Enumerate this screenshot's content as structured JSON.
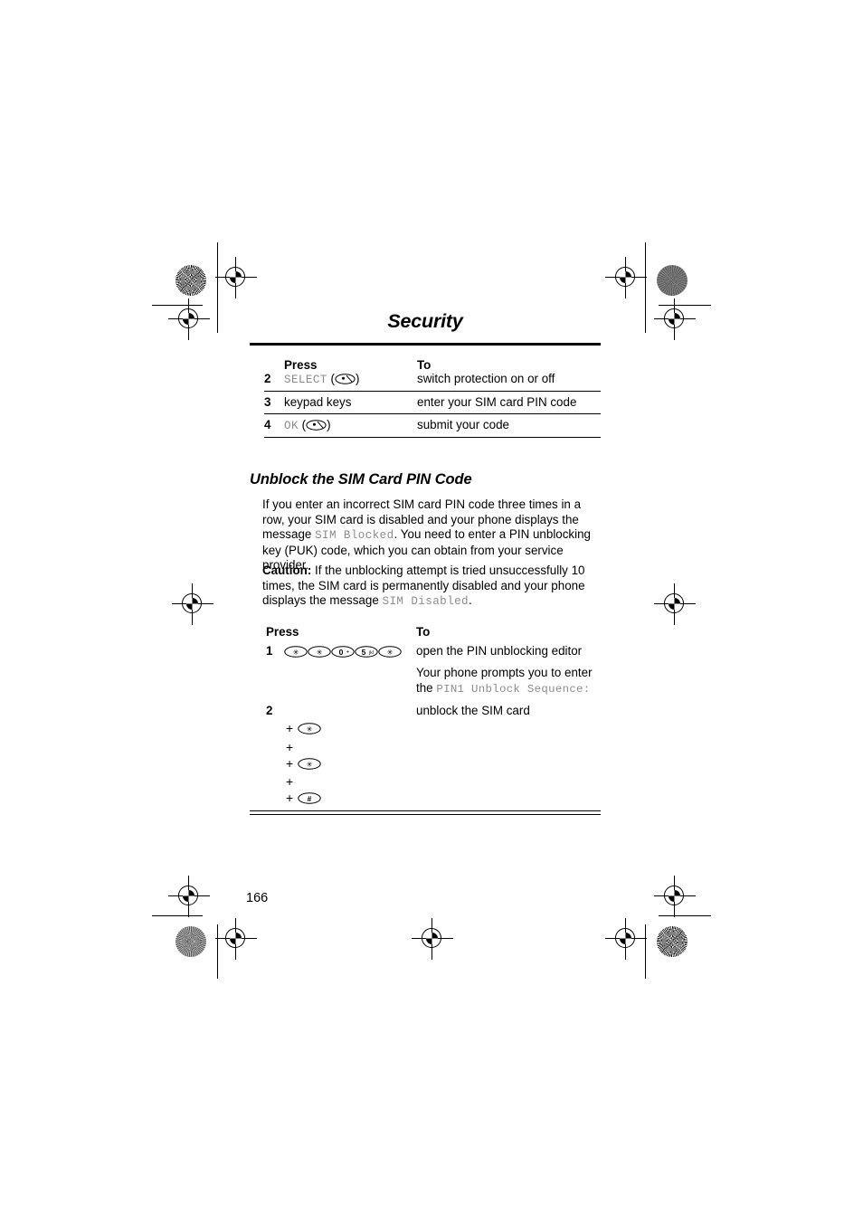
{
  "page": {
    "chapter_title": "Security",
    "page_number": "166",
    "section_heading": "Unblock the SIM Card PIN Code"
  },
  "table_one": {
    "header_press": "Press",
    "header_to": "To",
    "rows": [
      {
        "num": "2",
        "press_text": "SELECT",
        "press_style": "mono",
        "press_icon": "softkey-oval-icon",
        "to": "switch protection on or off"
      },
      {
        "num": "3",
        "press_text": "keypad keys",
        "press_style": "plain",
        "press_icon": "",
        "to": "enter your SIM card PIN code"
      },
      {
        "num": "4",
        "press_text": "OK",
        "press_style": "mono",
        "press_icon": "softkey-oval-icon",
        "to": "submit your code"
      }
    ]
  },
  "body": {
    "para1_part1": "If you enter an incorrect SIM card PIN code three times in a row, your SIM card is disabled and your phone displays the message ",
    "para1_code1": "SIM Blocked",
    "para1_part2": ". You need to enter a PIN unblocking key (PUK) code, which you can obtain from your service provider.",
    "para2_label": "Caution:",
    "para2_part1": " If the unblocking attempt is tried unsuccessfully 10 times, the SIM card is permanently disabled and your phone displays the message ",
    "para2_code1": "SIM Disabled",
    "para2_part2": "."
  },
  "table_two": {
    "header_press": "Press",
    "header_to": "To",
    "step1": {
      "num": "1",
      "keys": [
        {
          "label": "*",
          "sub": ""
        },
        {
          "label": "*",
          "sub": ""
        },
        {
          "label": "0",
          "sub": "+"
        },
        {
          "label": "5",
          "sub": "jkl"
        },
        {
          "label": "*",
          "sub": ""
        }
      ],
      "to_line1": "open the PIN unblocking editor",
      "to_line2a": "Your phone prompts you to enter the ",
      "to_line2b": "PIN1 Unblock Sequence:"
    },
    "step2": {
      "num": "2",
      "to": "unblock the SIM card",
      "sequence": [
        {
          "plus": "+",
          "key": "*"
        },
        {
          "plus": "+",
          "key": ""
        },
        {
          "plus": "+",
          "key": "*"
        },
        {
          "plus": "+",
          "key": ""
        },
        {
          "plus": "+",
          "key": "#"
        }
      ]
    }
  },
  "colors": {
    "ink": "#000000",
    "code_gray": "#8c8c8c",
    "paper": "#ffffff"
  }
}
